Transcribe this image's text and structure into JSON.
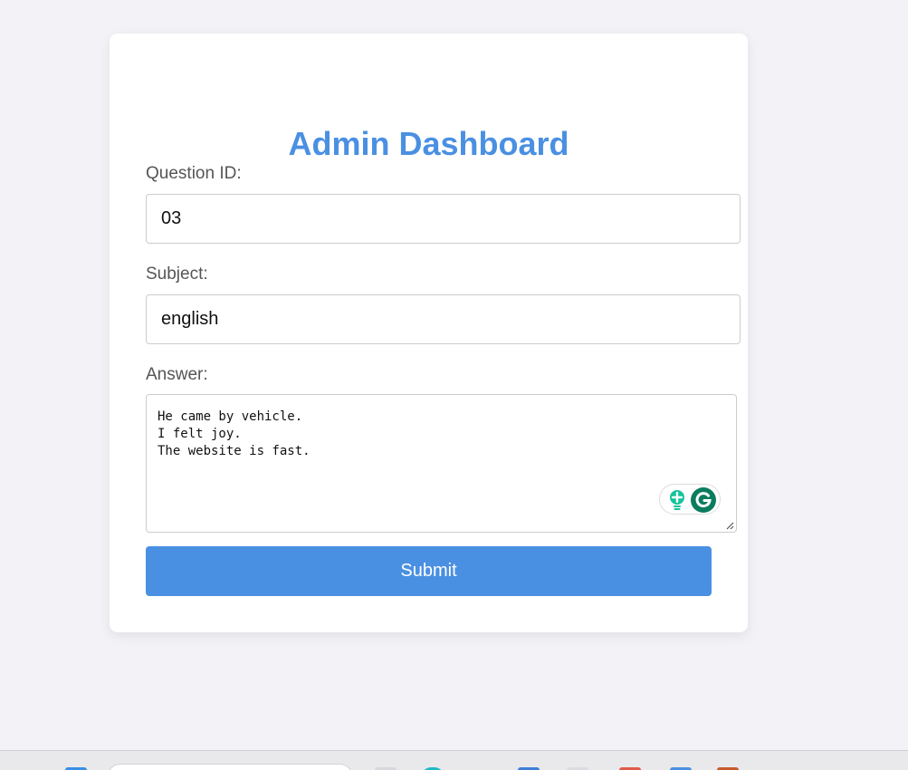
{
  "form": {
    "title": "Admin Dashboard",
    "question_id_label": "Question ID:",
    "question_id_value": "03",
    "subject_label": "Subject:",
    "subject_value": "english",
    "answer_label": "Answer:",
    "answer_value": "He came by vehicle.\nI felt joy.\nThe website is fast.",
    "submit_label": "Submit"
  },
  "grammarly": {
    "bulb_icon": "lightbulb-icon",
    "logo_icon": "grammarly-g-icon"
  },
  "colors": {
    "accent": "#4a90e2",
    "background": "#f3f3f7",
    "grammarly_green": "#15c39a",
    "grammarly_dark": "#0b7d5e"
  }
}
